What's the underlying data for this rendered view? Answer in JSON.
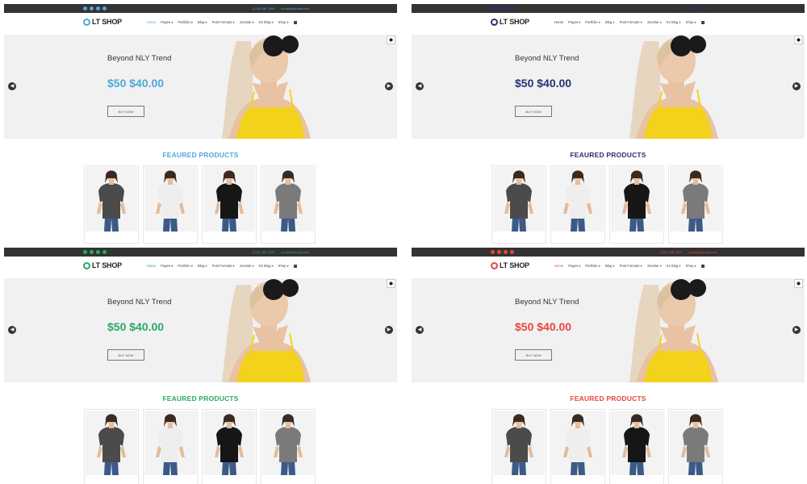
{
  "variants": [
    {
      "accent": "#4ea9d8"
    },
    {
      "accent": "#2c2f72"
    },
    {
      "accent": "#2aa965"
    },
    {
      "accent": "#e8463f"
    }
  ],
  "site": {
    "logo": "LT SHOP",
    "topbar": {
      "phone": "(123) 456 7890",
      "email": "contact@email.com"
    },
    "nav": [
      "Home",
      "Pages ▾",
      "Portfolio ▾",
      "Blog ▾",
      "Post Formats ▾",
      "Joomla! ▾",
      "K2 Blog ▾",
      "Shop ▾"
    ]
  },
  "hero": {
    "title": "Beyond NLY Trend",
    "price": "$50 $40.00",
    "button": "BUY NOW"
  },
  "featured": {
    "title": "FEAURED PRODUCTS",
    "products": [
      {
        "shirt": "#4b4b4b"
      },
      {
        "shirt": "#eeeeee"
      },
      {
        "shirt": "#161616"
      },
      {
        "shirt": "#7a7a7a"
      }
    ]
  }
}
